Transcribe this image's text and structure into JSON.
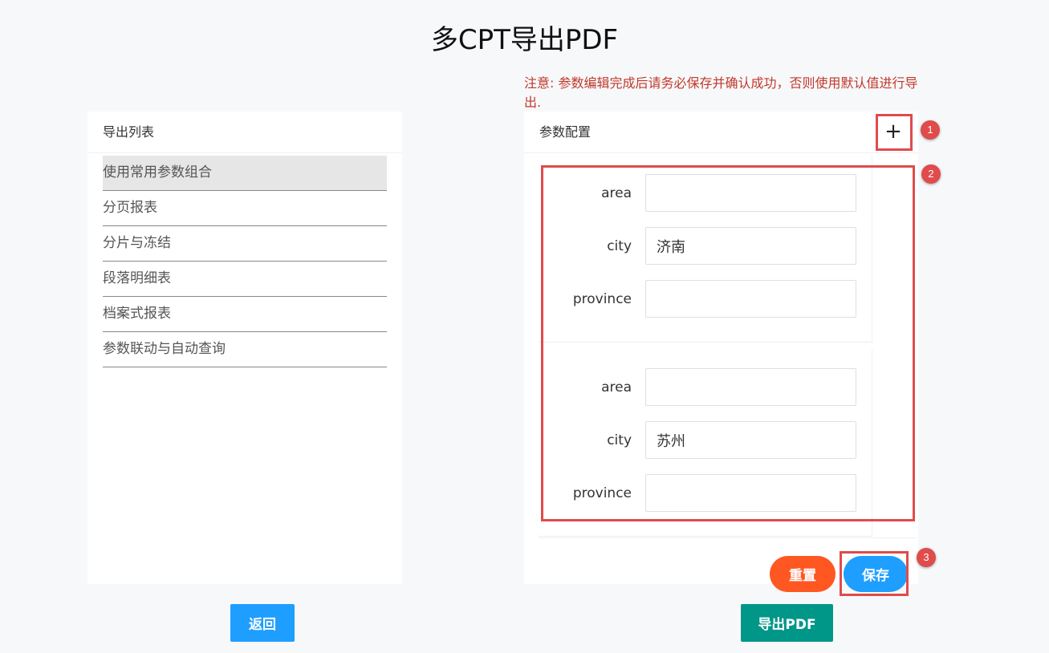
{
  "page": {
    "title": "多CPT导出PDF",
    "notice": "注意: 参数编辑完成后请务必保存并确认成功，否则使用默认值进行导出."
  },
  "export_list": {
    "header": "导出列表",
    "items": [
      {
        "label": "使用常用参数组合",
        "active": true
      },
      {
        "label": "分页报表"
      },
      {
        "label": "分片与冻结"
      },
      {
        "label": "段落明细表"
      },
      {
        "label": "档案式报表"
      },
      {
        "label": "参数联动与自动查询"
      }
    ]
  },
  "param_config": {
    "header": "参数配置",
    "add_icon": "+",
    "groups": [
      {
        "fields": [
          {
            "label": "area",
            "value": ""
          },
          {
            "label": "city",
            "value": "济南"
          },
          {
            "label": "province",
            "value": ""
          }
        ]
      },
      {
        "fields": [
          {
            "label": "area",
            "value": ""
          },
          {
            "label": "city",
            "value": "苏州"
          },
          {
            "label": "province",
            "value": ""
          }
        ]
      }
    ],
    "reset_label": "重置",
    "save_label": "保存"
  },
  "footer": {
    "back_label": "返回",
    "export_label": "导出PDF"
  },
  "annotations": {
    "badge1": "1",
    "badge2": "2",
    "badge3": "3",
    "color": "#e04b4b"
  },
  "colors": {
    "primary": "#1e9fff",
    "danger": "#ff5722",
    "success": "#009688",
    "notice": "#c0392b"
  }
}
